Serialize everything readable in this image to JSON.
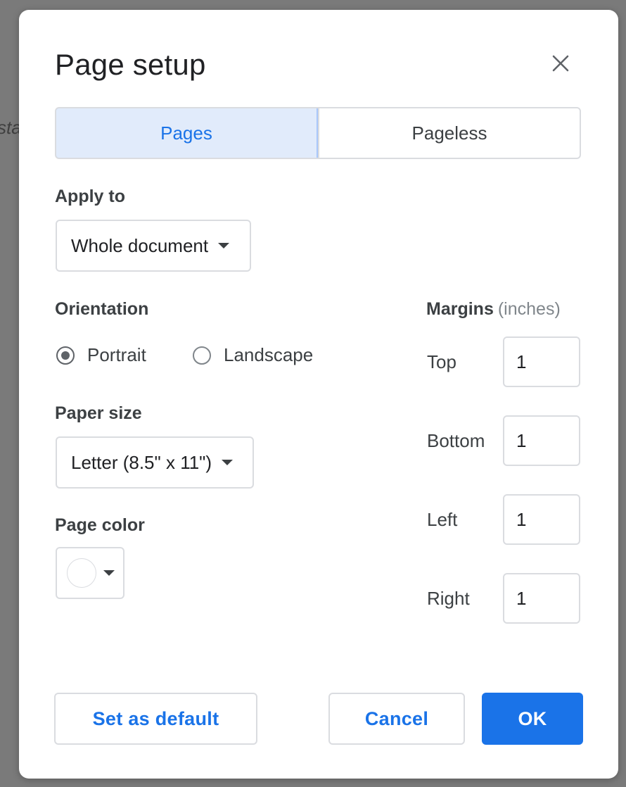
{
  "background": {
    "text": "sta"
  },
  "dialog": {
    "title": "Page setup",
    "close_icon": "close-icon",
    "tabs": [
      {
        "label": "Pages",
        "active": true
      },
      {
        "label": "Pageless",
        "active": false
      }
    ],
    "apply_to": {
      "label": "Apply to",
      "value": "Whole document"
    },
    "orientation": {
      "label": "Orientation",
      "options": [
        {
          "label": "Portrait",
          "selected": true
        },
        {
          "label": "Landscape",
          "selected": false
        }
      ]
    },
    "paper_size": {
      "label": "Paper size",
      "value": "Letter (8.5\" x 11\")"
    },
    "page_color": {
      "label": "Page color",
      "value": "#ffffff"
    },
    "margins": {
      "label": "Margins",
      "unit": "(inches)",
      "fields": [
        {
          "label": "Top",
          "value": "1"
        },
        {
          "label": "Bottom",
          "value": "1"
        },
        {
          "label": "Left",
          "value": "1"
        },
        {
          "label": "Right",
          "value": "1"
        }
      ]
    },
    "buttons": {
      "set_default": "Set as default",
      "cancel": "Cancel",
      "ok": "OK"
    }
  },
  "colors": {
    "accent": "#1a73e8",
    "active_tab_bg": "#e1ebfb",
    "border": "#dadce0"
  }
}
